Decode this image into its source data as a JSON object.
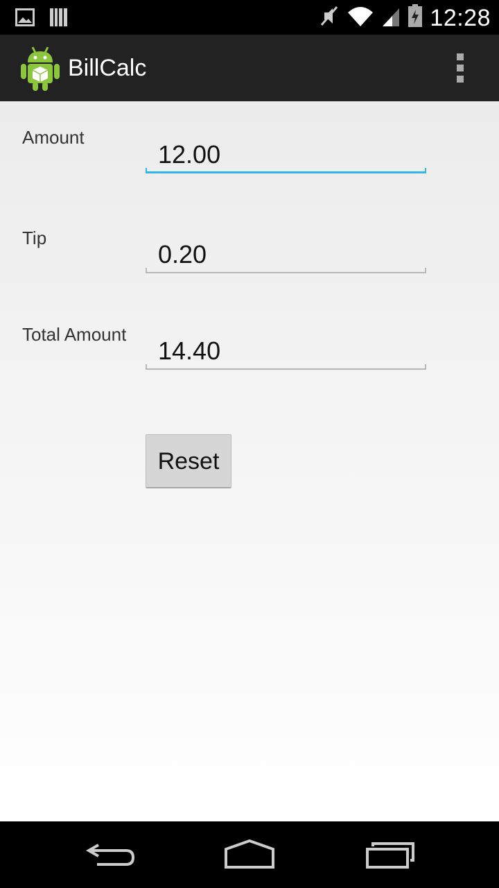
{
  "status_bar": {
    "time": "12:28",
    "icons": [
      "image-icon",
      "barcode-icon",
      "mute-icon",
      "wifi-icon",
      "signal-icon",
      "battery-charging-icon"
    ]
  },
  "action_bar": {
    "title": "BillCalc",
    "icons": [
      "android-app-icon",
      "overflow-menu-icon"
    ]
  },
  "form": {
    "amount_label": "Amount",
    "amount_value": "12.00",
    "tip_label": "Tip",
    "tip_value": "0.20",
    "total_label": "Total Amount",
    "total_value": "14.40",
    "reset_label": "Reset"
  },
  "nav_bar": {
    "icons": [
      "back-icon",
      "home-icon",
      "recents-icon"
    ]
  },
  "colors": {
    "focus_accent": "#33b5e5",
    "action_bar": "#222222"
  }
}
